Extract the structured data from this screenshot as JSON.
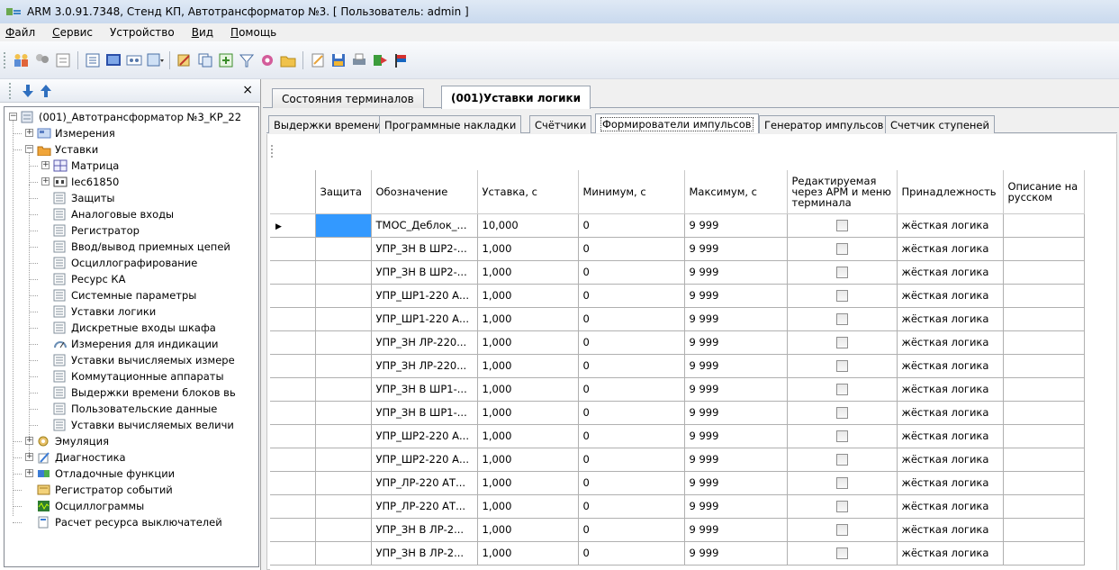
{
  "window": {
    "title": "ARM 3.0.91.7348, Стенд КП, Автотрансформатор №3. [ Пользователь: admin ]"
  },
  "menu": [
    {
      "u": "Ф",
      "rest": "айл"
    },
    {
      "u": "С",
      "rest": "ервис"
    },
    {
      "u": "",
      "rest": "Устройство"
    },
    {
      "u": "В",
      "rest": "ид"
    },
    {
      "u": "П",
      "rest": "омощь"
    }
  ],
  "toolbar": {
    "buttons": [
      "users-icon",
      "group-icon",
      "properties-icon",
      "list-icon",
      "screen-icon",
      "network-icon",
      "dropdown-table-icon",
      "edit-icon",
      "copy-icon",
      "add-icon",
      "filter-icon",
      "settings-icon",
      "folder-icon",
      "edit-doc-icon",
      "save-icon",
      "print-icon",
      "export-icon",
      "flag-icon"
    ],
    "colors": {
      "accent": "#3399ff"
    }
  },
  "left_panel": {
    "close": "×",
    "tree": [
      {
        "label": "(001)_Автотрансформатор №3_КР_22",
        "level": 0,
        "exp": "−",
        "icon": "device-icon"
      },
      {
        "label": "Измерения",
        "level": 1,
        "exp": "+",
        "icon": "measure-icon"
      },
      {
        "label": "Уставки",
        "level": 1,
        "exp": "−",
        "icon": "folder-settings-icon"
      },
      {
        "label": "Матрица",
        "level": 2,
        "exp": "+",
        "icon": "matrix-icon"
      },
      {
        "label": "Iec61850",
        "level": 2,
        "exp": "+",
        "icon": "iec-icon"
      },
      {
        "label": "Защиты",
        "level": 2,
        "exp": "",
        "icon": "table-icon"
      },
      {
        "label": "Аналоговые входы",
        "level": 2,
        "exp": "",
        "icon": "table-icon"
      },
      {
        "label": "Регистратор",
        "level": 2,
        "exp": "",
        "icon": "table-icon"
      },
      {
        "label": "Ввод/вывод приемных цепей",
        "level": 2,
        "exp": "",
        "icon": "table-icon"
      },
      {
        "label": "Осциллографирование",
        "level": 2,
        "exp": "",
        "icon": "table-icon"
      },
      {
        "label": "Ресурс КА",
        "level": 2,
        "exp": "",
        "icon": "table-icon"
      },
      {
        "label": "Системные параметры",
        "level": 2,
        "exp": "",
        "icon": "table-icon"
      },
      {
        "label": "Уставки логики",
        "level": 2,
        "exp": "",
        "icon": "table-icon"
      },
      {
        "label": "Дискретные входы шкафа",
        "level": 2,
        "exp": "",
        "icon": "table-icon"
      },
      {
        "label": "Измерения для индикации",
        "level": 2,
        "exp": "",
        "icon": "gauge-icon"
      },
      {
        "label": "Уставки вычисляемых измере",
        "level": 2,
        "exp": "",
        "icon": "table-icon"
      },
      {
        "label": "Коммутационные аппараты",
        "level": 2,
        "exp": "",
        "icon": "table-icon"
      },
      {
        "label": "Выдержки времени блоков вь",
        "level": 2,
        "exp": "",
        "icon": "table-icon"
      },
      {
        "label": "Пользовательские данные",
        "level": 2,
        "exp": "",
        "icon": "table-icon"
      },
      {
        "label": "Уставки вычисляемых величи",
        "level": 2,
        "exp": "",
        "icon": "table-icon"
      },
      {
        "label": "Эмуляция",
        "level": 1,
        "exp": "+",
        "icon": "emulation-icon"
      },
      {
        "label": "Диагностика",
        "level": 1,
        "exp": "+",
        "icon": "diagnostics-icon"
      },
      {
        "label": "Отладочные функции",
        "level": 1,
        "exp": "+",
        "icon": "debug-icon"
      },
      {
        "label": "Регистратор событий",
        "level": 1,
        "exp": "",
        "icon": "events-icon"
      },
      {
        "label": "Осциллограммы",
        "level": 1,
        "exp": "",
        "icon": "oscillogram-icon"
      },
      {
        "label": "Расчет ресурса выключателей",
        "level": 1,
        "exp": "",
        "icon": "calc-icon"
      }
    ]
  },
  "doc_tabs": [
    "Состояния терминалов",
    "(001)Уставки логики"
  ],
  "sub_tabs": [
    "Выдержки времени",
    "Программные накладки",
    "Счётчики",
    "Формирователи импульсов",
    "Генератор импульсов",
    "Счетчик ступеней"
  ],
  "grid": {
    "headers": [
      "Защита",
      "Обозначение",
      "Уставка, с",
      "Минимум, с",
      "Максимум, с",
      "Редактируемая через АРМ и меню терминала",
      "Принадлежность",
      "Описание на русском"
    ],
    "rows": [
      [
        "",
        "ТМОС_Деблок_...",
        "10,000",
        "0",
        "9 999",
        "",
        "жёсткая логика",
        ""
      ],
      [
        "",
        "УПР_ЗН В ШР2-...",
        "1,000",
        "0",
        "9 999",
        "",
        "жёсткая логика",
        ""
      ],
      [
        "",
        "УПР_ЗН В ШР2-...",
        "1,000",
        "0",
        "9 999",
        "",
        "жёсткая логика",
        ""
      ],
      [
        "",
        "УПР_ШР1-220 А...",
        "1,000",
        "0",
        "9 999",
        "",
        "жёсткая логика",
        ""
      ],
      [
        "",
        "УПР_ШР1-220 А...",
        "1,000",
        "0",
        "9 999",
        "",
        "жёсткая логика",
        ""
      ],
      [
        "",
        "УПР_ЗН ЛР-220...",
        "1,000",
        "0",
        "9 999",
        "",
        "жёсткая логика",
        ""
      ],
      [
        "",
        "УПР_ЗН ЛР-220...",
        "1,000",
        "0",
        "9 999",
        "",
        "жёсткая логика",
        ""
      ],
      [
        "",
        "УПР_ЗН В ШР1-...",
        "1,000",
        "0",
        "9 999",
        "",
        "жёсткая логика",
        ""
      ],
      [
        "",
        "УПР_ЗН В ШР1-...",
        "1,000",
        "0",
        "9 999",
        "",
        "жёсткая логика",
        ""
      ],
      [
        "",
        "УПР_ШР2-220 А...",
        "1,000",
        "0",
        "9 999",
        "",
        "жёсткая логика",
        ""
      ],
      [
        "",
        "УПР_ШР2-220 А...",
        "1,000",
        "0",
        "9 999",
        "",
        "жёсткая логика",
        ""
      ],
      [
        "",
        "УПР_ЛР-220 АТ...",
        "1,000",
        "0",
        "9 999",
        "",
        "жёсткая логика",
        ""
      ],
      [
        "",
        "УПР_ЛР-220 АТ...",
        "1,000",
        "0",
        "9 999",
        "",
        "жёсткая логика",
        ""
      ],
      [
        "",
        "УПР_ЗН В ЛР-2...",
        "1,000",
        "0",
        "9 999",
        "",
        "жёсткая логика",
        ""
      ],
      [
        "",
        "УПР_ЗН В ЛР-2...",
        "1,000",
        "0",
        "9 999",
        "",
        "жёсткая логика",
        ""
      ]
    ]
  }
}
